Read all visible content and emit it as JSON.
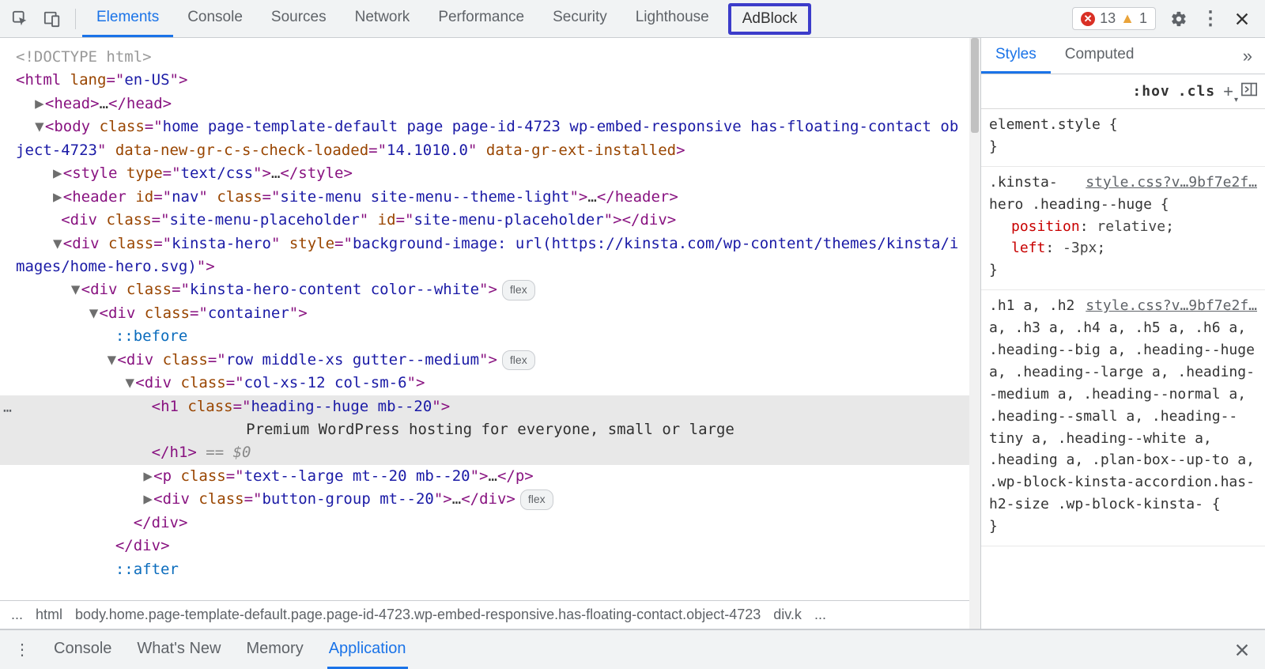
{
  "toolbar": {
    "tabs": [
      "Elements",
      "Console",
      "Sources",
      "Network",
      "Performance",
      "Security",
      "Lighthouse",
      "AdBlock"
    ],
    "active_tab": "Elements",
    "highlighted_tab": "AdBlock",
    "errors": "13",
    "warnings": "1"
  },
  "dom": {
    "doctype": "<!DOCTYPE html>",
    "html_open": {
      "tag": "html",
      "attrs": [
        [
          "lang",
          "en-US"
        ]
      ]
    },
    "head": {
      "tag": "head",
      "ellipsis": "…"
    },
    "body_open": {
      "tag": "body",
      "attrs": [
        [
          "class",
          "home page-template-default page page-id-4723 wp-embed-responsive has-floating-contact object-4723"
        ],
        [
          "data-new-gr-c-s-check-loaded",
          "14.1010.0"
        ],
        [
          "data-gr-ext-installed",
          ""
        ]
      ]
    },
    "style_child": {
      "tag": "style",
      "attrs": [
        [
          "type",
          "text/css"
        ]
      ],
      "ellipsis": "…"
    },
    "header_child": {
      "tag": "header",
      "attrs": [
        [
          "id",
          "nav"
        ],
        [
          "class",
          "site-menu site-menu--theme-light"
        ]
      ],
      "ellipsis": "…"
    },
    "placeholder_div": {
      "tag": "div",
      "attrs": [
        [
          "class",
          "site-menu-placeholder"
        ],
        [
          "id",
          "site-menu-placeholder"
        ]
      ]
    },
    "hero_div": {
      "tag": "div",
      "attrs": [
        [
          "class",
          "kinsta-hero"
        ],
        [
          "style",
          "background-image: url(https://kinsta.com/wp-content/themes/kinsta/images/home-hero.svg)"
        ]
      ]
    },
    "hero_content": {
      "tag": "div",
      "attrs": [
        [
          "class",
          "kinsta-hero-content color--white"
        ]
      ],
      "badge": "flex"
    },
    "container": {
      "tag": "div",
      "attrs": [
        [
          "class",
          "container"
        ]
      ]
    },
    "before": "::before",
    "row": {
      "tag": "div",
      "attrs": [
        [
          "class",
          "row middle-xs gutter--medium"
        ]
      ],
      "badge": "flex"
    },
    "col": {
      "tag": "div",
      "attrs": [
        [
          "class",
          "col-xs-12 col-sm-6"
        ]
      ]
    },
    "h1_open": {
      "tag": "h1",
      "attrs": [
        [
          "class",
          "heading--huge mb--20"
        ]
      ]
    },
    "h1_text": "Premium WordPress hosting for everyone, small or large",
    "h1_close": "h1",
    "eqvar": "== $0",
    "p": {
      "tag": "p",
      "attrs": [
        [
          "class",
          "text--large mt--20 mb--20"
        ]
      ],
      "ellipsis": "…"
    },
    "btn_group": {
      "tag": "div",
      "attrs": [
        [
          "class",
          "button-group mt--20"
        ]
      ],
      "ellipsis": "…",
      "badge": "flex"
    },
    "div_close1": "div",
    "div_close2": "div",
    "after": "::after"
  },
  "crumbs": {
    "prefix": "...",
    "items": [
      "html",
      "body.home.page-template-default.page.page-id-4723.wp-embed-responsive.has-floating-contact.object-4723",
      "div.k"
    ],
    "suffix": "..."
  },
  "styles": {
    "tabs": [
      "Styles",
      "Computed"
    ],
    "active": "Styles",
    "filter_placeholder": "",
    "hov": ":hov",
    "cls": ".cls",
    "rules": [
      {
        "source": "",
        "selector": "element.style",
        "decls": []
      },
      {
        "source": "style.css?v…9bf7e2f…",
        "selector": ".kinsta-hero .heading--huge",
        "decls": [
          [
            "position",
            "relative"
          ],
          [
            "left",
            "-3px"
          ]
        ]
      },
      {
        "source": "style.css?v…9bf7e2f…",
        "selector": ".h1 a, .h2 a, .h3 a, .h4 a, .h5 a, .h6 a, .heading--big a, .heading--huge a, .heading--large a, .heading--medium a, .heading--normal a, .heading--small a, .heading--tiny a, .heading--white a, .heading a, .plan-box--up-to a, .wp-block-kinsta-accordion.has-h2-size .wp-block-kinsta-",
        "decls": []
      }
    ]
  },
  "drawer": {
    "tabs": [
      "Console",
      "What's New",
      "Memory",
      "Application"
    ],
    "active": "Application"
  }
}
